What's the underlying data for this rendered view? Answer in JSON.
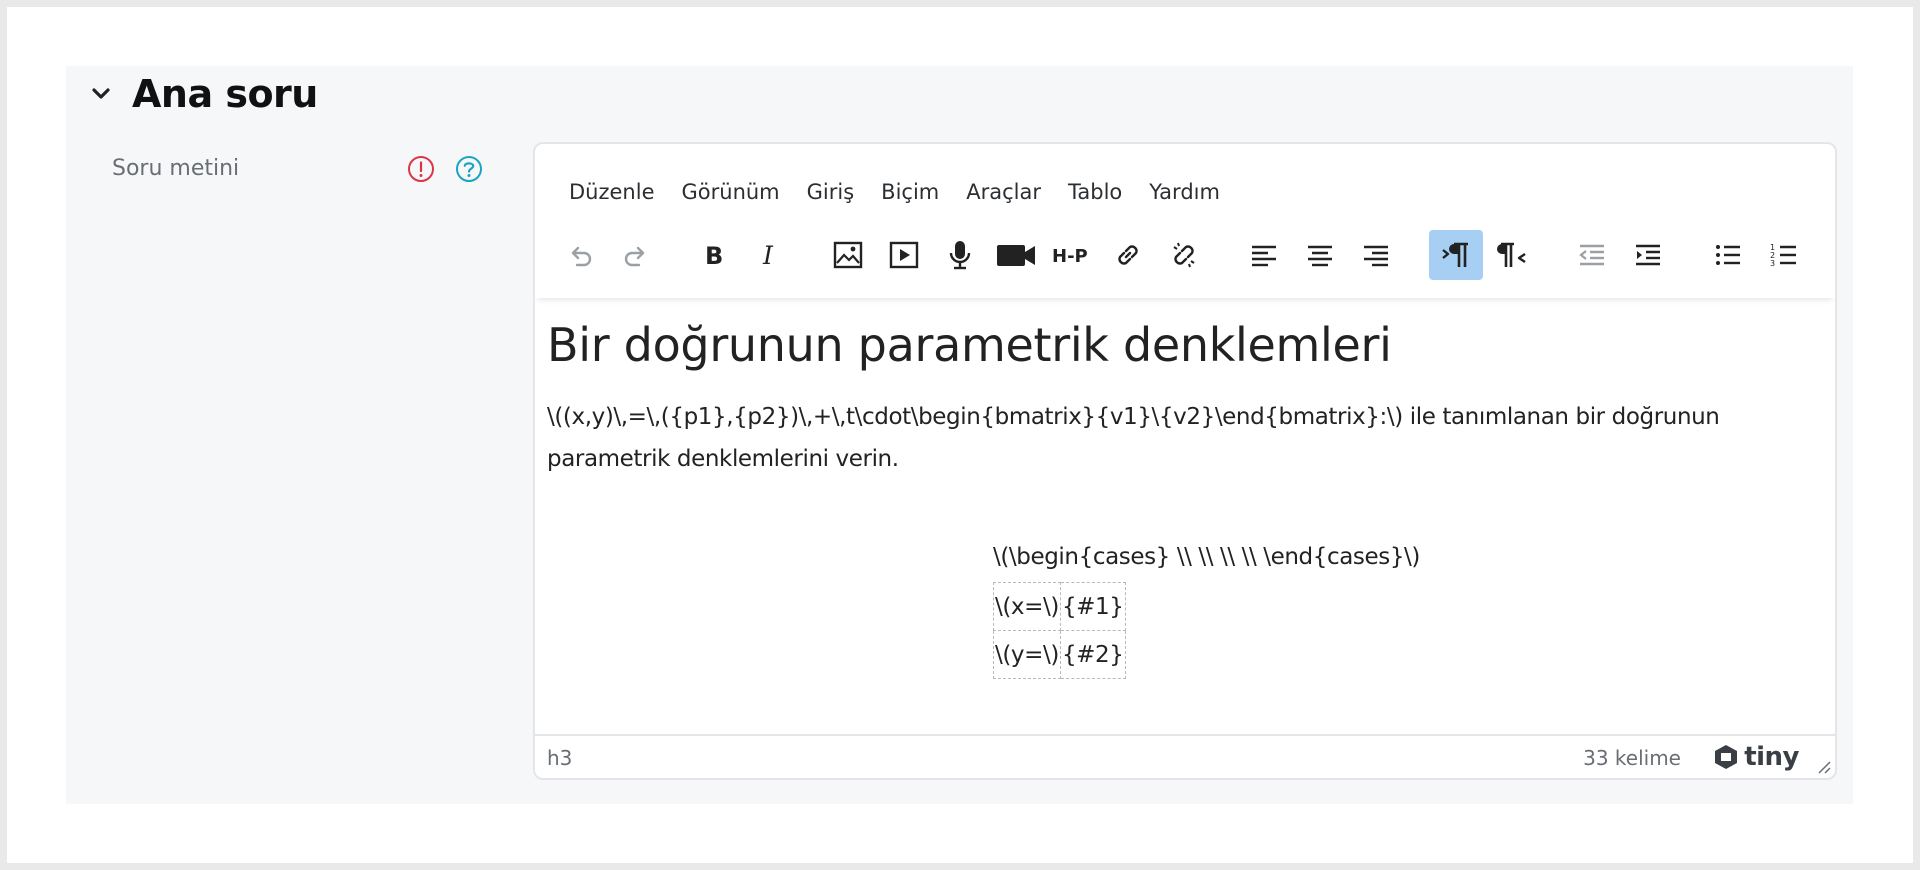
{
  "section": {
    "title": "Ana soru"
  },
  "field": {
    "label": "Soru metini"
  },
  "menubar": {
    "items": [
      "Düzenle",
      "Görünüm",
      "Giriş",
      "Biçim",
      "Araçlar",
      "Tablo",
      "Yardım"
    ]
  },
  "toolbar": {
    "h5p_label": "H-P",
    "active_color": "#a7cef3"
  },
  "content": {
    "heading": "Bir doğrunun parametrik denklemleri",
    "paragraph": "\\((x,y)\\,=\\,({p1},{p2})\\,+\\,t\\cdot\\begin{bmatrix}{v1}\\{v2}\\end{bmatrix}:\\) ile tanımlanan bir doğrunun parametrik denklemlerini verin.",
    "cases_line": "\\(\\begin{cases} \\\\ \\\\ \\\\ \\\\ \\end{cases}\\)",
    "rows": [
      {
        "label": "\\(x=\\)",
        "value": "{#1}"
      },
      {
        "label": "\\(y=\\)",
        "value": "{#2}"
      }
    ]
  },
  "statusbar": {
    "path": "h3",
    "word_count": "33 kelime",
    "brand": "tiny"
  }
}
